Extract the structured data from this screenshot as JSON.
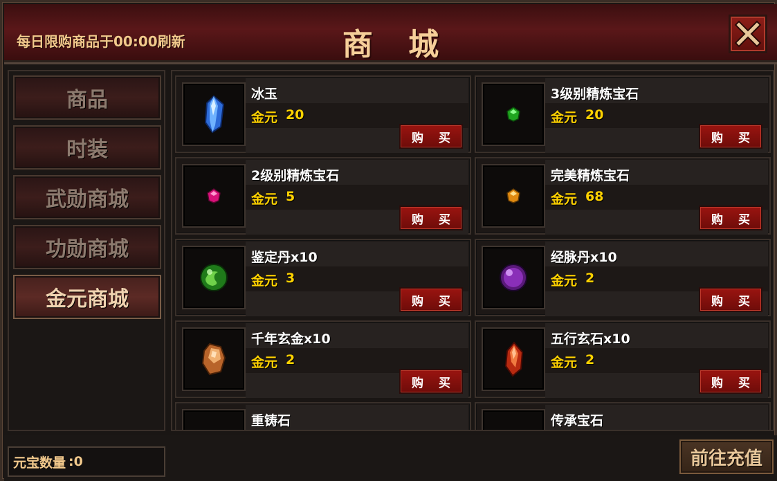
{
  "header": {
    "notice": "每日限购商品于00:00刷新",
    "title": "商 城"
  },
  "sidebar": {
    "tabs": [
      {
        "label": "商品"
      },
      {
        "label": "时装"
      },
      {
        "label": "武勋商城"
      },
      {
        "label": "功勋商城"
      },
      {
        "label": "金元商城"
      }
    ],
    "active_index": 4
  },
  "items": [
    {
      "name": "冰玉",
      "currency": "金元",
      "price": "20",
      "buy_label": "购 买",
      "icon": "ice-jade-crystal-icon"
    },
    {
      "name": "3级别精炼宝石",
      "currency": "金元",
      "price": "20",
      "buy_label": "购 买",
      "icon": "green-gem-icon"
    },
    {
      "name": "2级别精炼宝石",
      "currency": "金元",
      "price": "5",
      "buy_label": "购 买",
      "icon": "pink-gem-icon"
    },
    {
      "name": "完美精炼宝石",
      "currency": "金元",
      "price": "68",
      "buy_label": "购 买",
      "icon": "orange-gem-icon"
    },
    {
      "name": "鉴定丹x10",
      "currency": "金元",
      "price": "3",
      "buy_label": "购 买",
      "icon": "green-orb-icon"
    },
    {
      "name": "经脉丹x10",
      "currency": "金元",
      "price": "2",
      "buy_label": "购 买",
      "icon": "purple-orb-icon"
    },
    {
      "name": "千年玄金x10",
      "currency": "金元",
      "price": "2",
      "buy_label": "购 买",
      "icon": "gold-ore-icon"
    },
    {
      "name": "五行玄石x10",
      "currency": "金元",
      "price": "2",
      "buy_label": "购 买",
      "icon": "red-crystal-icon"
    },
    {
      "name": "重铸石",
      "icon": "recast-stone-icon"
    },
    {
      "name": "传承宝石",
      "icon": "inherit-gem-icon"
    }
  ],
  "footer": {
    "ingot_label": "元宝数量",
    "ingot_value": ":0",
    "recharge_label": "前往充值"
  },
  "colors": {
    "header_red": "#5a1719",
    "price_yellow": "#ffd200",
    "buy_button_red": "#9a1410",
    "title_gold": "#f6cf99"
  }
}
